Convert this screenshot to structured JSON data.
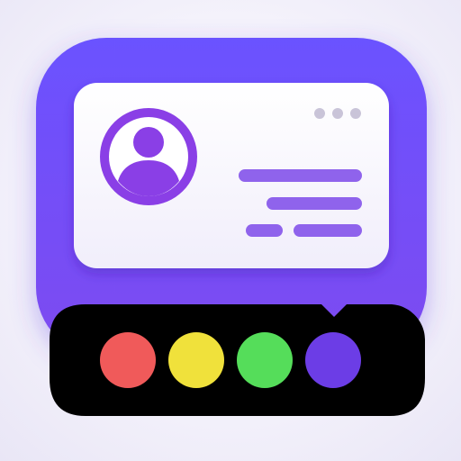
{
  "icon": {
    "name": "profile-widget-app-icon",
    "frame_gradient_top": "#6b52ff",
    "frame_gradient_bottom": "#7d4bf0",
    "card_background": "#f1eefb",
    "avatar_color": "#8a3fe6",
    "text_line_color": "#8f63ec",
    "dots_color": "#c9c4d8",
    "dock_background": "#000000",
    "palette": [
      {
        "name": "red",
        "color": "#f05a5a"
      },
      {
        "name": "yellow",
        "color": "#f0e13a"
      },
      {
        "name": "green",
        "color": "#55dd5a"
      },
      {
        "name": "purple",
        "color": "#6c3ee6"
      }
    ]
  }
}
